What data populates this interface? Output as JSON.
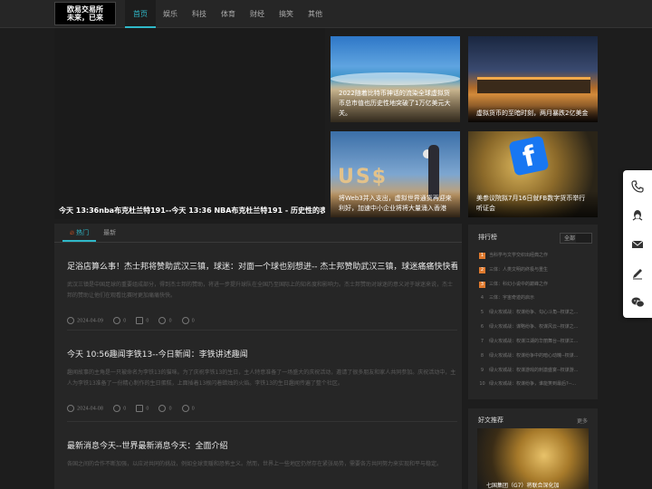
{
  "logo": {
    "line1": "欧易交易所",
    "line2": "未来，已来"
  },
  "nav": [
    "首页",
    "娱乐",
    "科技",
    "体育",
    "财经",
    "搞笑",
    "其他"
  ],
  "hero": {
    "caption": "今天 13:36nba布克杜兰特191--今天 13:36 NBA布克杜兰特191 - 历史性的表现与不朽之路"
  },
  "tiles": [
    {
      "caption": "2022随着比特币神话的流染全球虚拟货币总市值也历史性地突破了1万亿美元大关。"
    },
    {
      "caption": "虚拟货币的至暗时刻，两月暴跌2亿美金"
    },
    {
      "caption": "将Web3并入支出，虚拟世界通货再迎来利好，加速中小企业将将大量涌入香港"
    },
    {
      "caption": "美参议院拟7月16日就FB数字货币举行听证会"
    }
  ],
  "tabs": {
    "hot": "热门",
    "latest": "最新"
  },
  "articles": [
    {
      "title": "足浴店算么事！杰士邦将赞助武汉三镇，球迷：对面一个球也别想进-- 杰士邦赞助武汉三镇，球迷痛痛快快看",
      "summary": "武汉三镇是中国足球的重要组成部分，得到杰士邦的赞助，将进一步提升球队在全国乃至国际上的知名度和影响力。杰士邦赞助对球迷的意义对于球迷来说，杰士邦的赞助让他们在观看比赛时更加痛痛快快。",
      "date": "2024-04-09",
      "views": "0",
      "comments": "0",
      "likes": "0",
      "favs": "0"
    },
    {
      "title": "今天 10:56趣闻李铁13--今日新闻：李铁讲述趣闻",
      "summary": "趣闻故事的主角是一只被命名为李铁13的猫咪。为了庆祝李铁13的生日，主人特意准备了一场盛大的庆祝活动，邀请了很多朋友和家人共同参加。庆祝活动中，主人为李铁13准备了一份精心制作的生日蛋糕，上面插着13根闪着蜡烛的火焰。李铁13的生日趣闻传遍了整个社区。",
      "date": "2024-04-08",
      "views": "0",
      "comments": "0",
      "likes": "0",
      "favs": "0"
    },
    {
      "title": "最新消息今天--世界最新消息今天：全面介绍",
      "summary": "各国之间的合作不断加强，以应对共同的挑战，例如全球变暖和恐怖主义。然而，世界上一些地区仍然存在紧张局势，需要各方共同努力来实现和平与稳定。",
      "date": "",
      "views": "",
      "comments": "",
      "likes": "",
      "favs": ""
    }
  ],
  "ranking": {
    "title": "排行榜",
    "filter": "全部",
    "items": [
      {
        "num": "1",
        "text": "当科学与文学交织出经典之作"
      },
      {
        "num": "2",
        "text": "三体：人类文明的终极与重生"
      },
      {
        "num": "3",
        "text": "三体：科幻小说中的巅峰之作"
      },
      {
        "num": "4",
        "text": "三体：宇宙奇迹的启示"
      },
      {
        "num": "5",
        "text": "绿火攻城战：权谋纷争、勾心斗角--权谋之..."
      },
      {
        "num": "6",
        "text": "绿火攻城战：谋略纷争、权谋风云--权谋之..."
      },
      {
        "num": "7",
        "text": "绿火攻城战：权谋江湖的华丽舞台--权谋江..."
      },
      {
        "num": "8",
        "text": "绿火攻城战：权谋纷争中的暗心动魄--权谋..."
      },
      {
        "num": "9",
        "text": "绿火攻城战：权谋游戏的刺激盛宴--权谋游..."
      },
      {
        "num": "10",
        "text": "绿火攻城战：权谋纷争，谁能笑到最后?--..."
      }
    ]
  },
  "good": {
    "title": "好文推荐",
    "more": "更多",
    "caption": "七国集团（G7）将联合深化加"
  },
  "colors": {
    "accent": "#2fb8c8",
    "rank_top": "#e07a2e"
  },
  "float_icons": [
    "phone-icon",
    "qq-icon",
    "mail-icon",
    "edit-icon",
    "wechat-icon"
  ]
}
